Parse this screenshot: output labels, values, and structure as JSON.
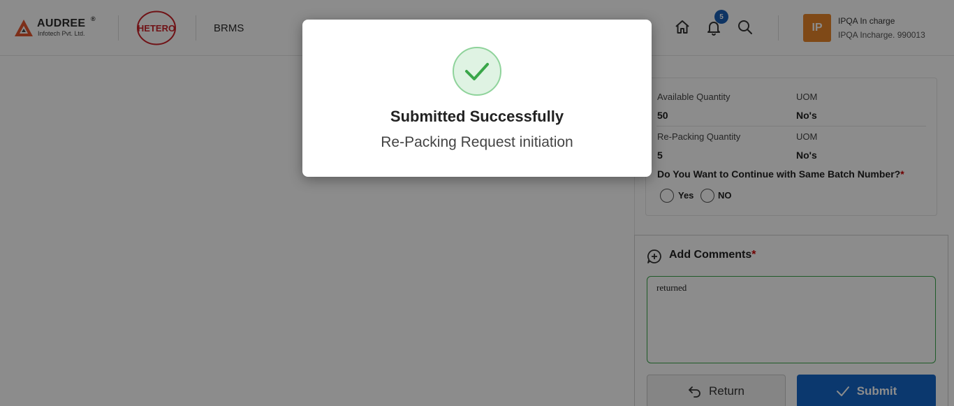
{
  "header": {
    "logo_brand": "AUDREE",
    "logo_registered": "®",
    "logo_subtitle": "Infotech Pvt. Ltd.",
    "client_logo": "HETERO",
    "app_name": "BRMS",
    "notification_count": "5",
    "user": {
      "initials": "IP",
      "name": "IPQA In charge",
      "role": "IPQA Incharge. 990013"
    },
    "icons": [
      "home-icon",
      "bell-icon",
      "search-icon"
    ]
  },
  "details": {
    "available_quantity_label": "Available Quantity",
    "available_quantity_value": "50",
    "uom_label_1": "UOM",
    "uom_value_1": "No's",
    "repacking_quantity_label": "Re-Packing Quantity",
    "repacking_quantity_value": "5",
    "uom_label_2": "UOM",
    "uom_value_2": "No's",
    "batch_question": "Do You Want to Continue with Same Batch Number?",
    "required_mark": "*",
    "option_yes": "Yes",
    "option_no": "NO"
  },
  "comments": {
    "title": "Add Comments",
    "required_mark": "*",
    "value": "returned"
  },
  "actions": {
    "return_label": "Return",
    "submit_label": "Submit"
  },
  "modal": {
    "title": "Submitted Successfully",
    "message": "Re-Packing Request initiation"
  },
  "colors": {
    "primary": "#1467c9",
    "success": "#3aa64a",
    "avatar": "#e8862b",
    "hetero_red": "#cc2229"
  }
}
